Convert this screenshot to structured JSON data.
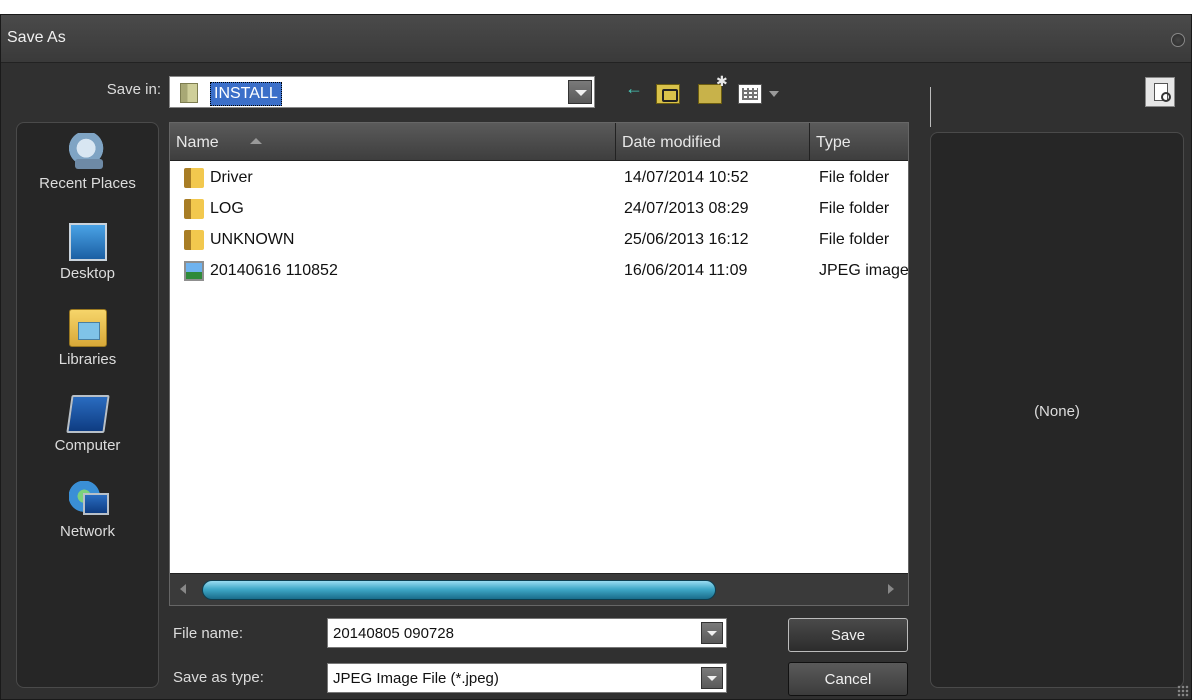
{
  "window": {
    "title": "Save As"
  },
  "toolbar": {
    "save_in_label": "Save in:",
    "current_folder": "INSTALL"
  },
  "places": [
    {
      "label": "Recent Places",
      "icon": "recent-places-icon"
    },
    {
      "label": "Desktop",
      "icon": "desktop-icon"
    },
    {
      "label": "Libraries",
      "icon": "libraries-icon"
    },
    {
      "label": "Computer",
      "icon": "computer-icon"
    },
    {
      "label": "Network",
      "icon": "network-icon"
    }
  ],
  "file_list": {
    "columns": {
      "name": "Name",
      "date": "Date modified",
      "type": "Type"
    },
    "rows": [
      {
        "name": "Driver",
        "date": "14/07/2014 10:52",
        "type": "File folder",
        "icon": "folder-icon"
      },
      {
        "name": "LOG",
        "date": "24/07/2013 08:29",
        "type": "File folder",
        "icon": "folder-icon"
      },
      {
        "name": "UNKNOWN",
        "date": "25/06/2013 16:12",
        "type": "File folder",
        "icon": "folder-icon"
      },
      {
        "name": "20140616 110852",
        "date": "16/06/2014 11:09",
        "type": "JPEG image",
        "icon": "jpeg-image-icon"
      }
    ]
  },
  "form": {
    "file_name_label": "File name:",
    "file_name_value": "20140805 090728",
    "save_type_label": "Save as type:",
    "save_type_value": "JPEG Image File (*.jpeg)"
  },
  "buttons": {
    "save": "Save",
    "cancel": "Cancel"
  },
  "preview": {
    "text": "(None)"
  }
}
